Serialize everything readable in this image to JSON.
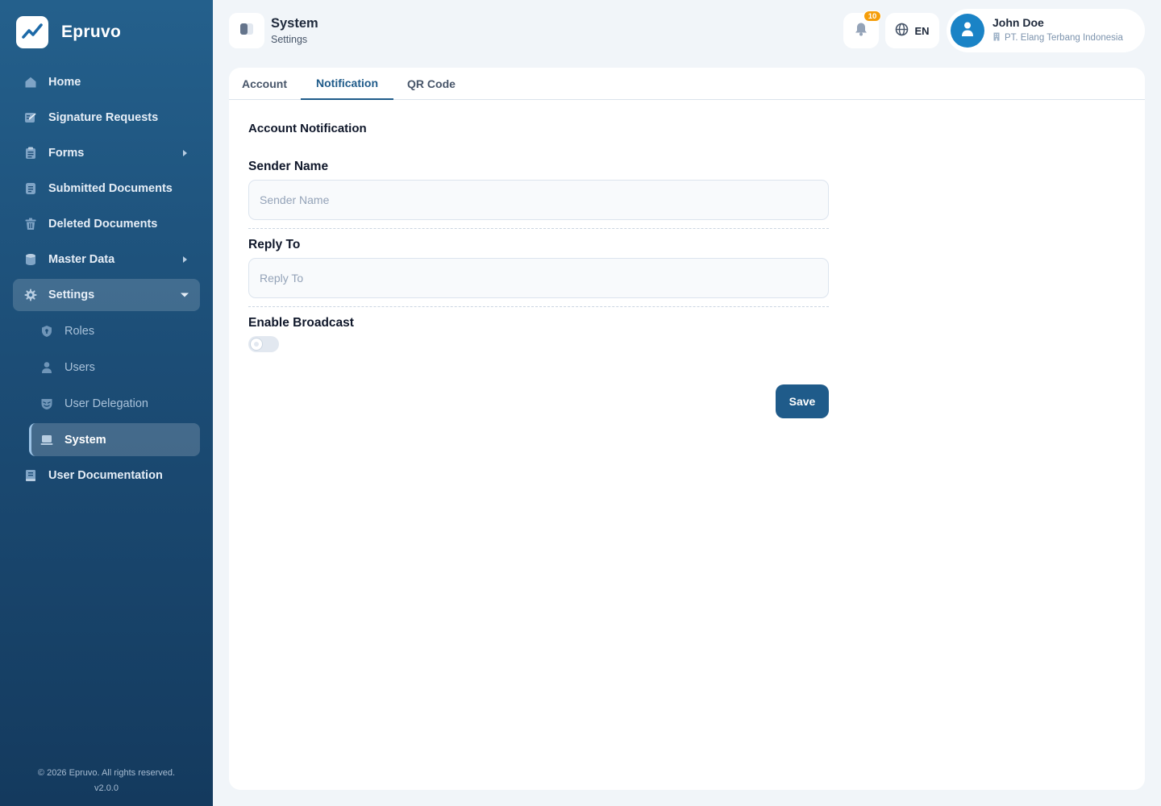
{
  "brand": {
    "name": "Epruvo",
    "logo_icon": "trend-chart-icon"
  },
  "sidebar": {
    "items": [
      {
        "label": "Home",
        "icon": "home-icon"
      },
      {
        "label": "Signature Requests",
        "icon": "signature-icon"
      },
      {
        "label": "Forms",
        "icon": "clipboard-icon",
        "expandable": true
      },
      {
        "label": "Submitted Documents",
        "icon": "document-icon"
      },
      {
        "label": "Deleted Documents",
        "icon": "trash-icon"
      },
      {
        "label": "Master Data",
        "icon": "database-icon",
        "expandable": true
      },
      {
        "label": "Settings",
        "icon": "gear-icon",
        "expanded": true,
        "active": true
      },
      {
        "label": "User Documentation",
        "icon": "book-icon"
      }
    ],
    "settings_children": [
      {
        "label": "Roles",
        "icon": "shield-icon"
      },
      {
        "label": "Users",
        "icon": "user-icon"
      },
      {
        "label": "User Delegation",
        "icon": "delegation-icon"
      },
      {
        "label": "System",
        "icon": "laptop-icon",
        "active": true
      }
    ],
    "footer": {
      "copyright": "© 2026 Epruvo. All rights reserved.",
      "version": "v2.0.0"
    }
  },
  "header": {
    "title": "System",
    "subtitle": "Settings",
    "notifications": {
      "count": "10",
      "icon": "bell-icon"
    },
    "language": {
      "code": "EN",
      "icon": "globe-icon"
    },
    "user": {
      "name": "John Doe",
      "company": "PT. Elang Terbang Indonesia",
      "company_icon": "building-icon"
    }
  },
  "tabs": [
    {
      "label": "Account",
      "active": false
    },
    {
      "label": "Notification",
      "active": true
    },
    {
      "label": "QR Code",
      "active": false
    }
  ],
  "form": {
    "section_title": "Account Notification",
    "sender_name": {
      "label": "Sender Name",
      "placeholder": "Sender Name",
      "value": ""
    },
    "reply_to": {
      "label": "Reply To",
      "placeholder": "Reply To",
      "value": ""
    },
    "enable_broadcast": {
      "label": "Enable Broadcast",
      "enabled": false
    },
    "save_label": "Save"
  },
  "colors": {
    "primary": "#1f5b8a",
    "sidebar_top": "#24608c",
    "sidebar_bottom": "#143a5e",
    "badge": "#f59e0b",
    "avatar": "#1a83c6",
    "background": "#f1f5f9"
  }
}
